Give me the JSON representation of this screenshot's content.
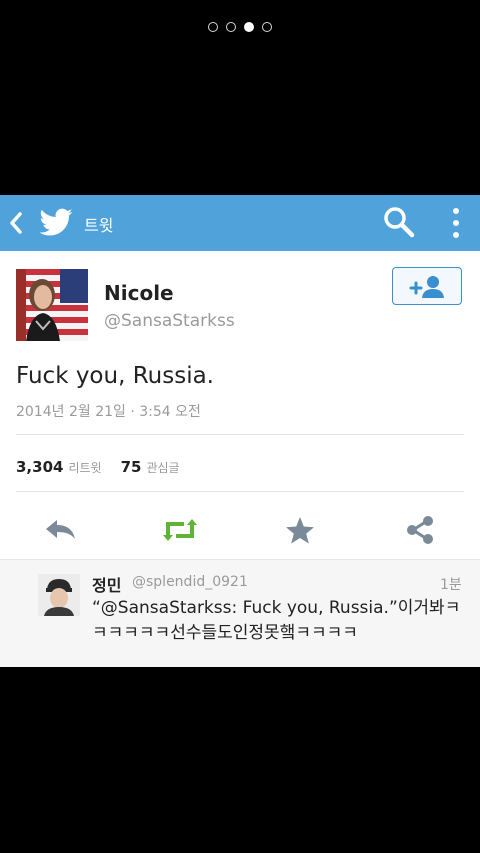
{
  "pager": {
    "count": 4,
    "active_index": 2
  },
  "appbar": {
    "title": "트윗",
    "color": "#4fa3da"
  },
  "tweet": {
    "name": "Nicole",
    "handle": "@SansaStarkss",
    "text": "Fuck you, Russia.",
    "timestamp": "2014년 2월 21일 · 3:54 오전",
    "retweets_count": "3,304",
    "retweets_label": "리트윗",
    "favorites_count": "75",
    "favorites_label": "관심글"
  },
  "icons": {
    "back": "chevron-left-icon",
    "logo": "twitter-bird-icon",
    "search": "search-icon",
    "overflow": "overflow-menu-icon",
    "follow": "follow-user-icon",
    "reply": "reply-icon",
    "retweet": "retweet-icon",
    "favorite": "star-icon",
    "share": "share-icon"
  },
  "reply": {
    "name": "정민",
    "handle": "@splendid_0921",
    "time": "1분",
    "text": "“@SansaStarkss: Fuck you, Russia.”이거봐ㅋㅋㅋㅋㅋㅋ선수들도인정못햌ㅋㅋㅋㅋ"
  },
  "colors": {
    "accent": "#4fa3da",
    "retweet_green": "#5fb336",
    "icon_gray": "#7a8a98"
  }
}
